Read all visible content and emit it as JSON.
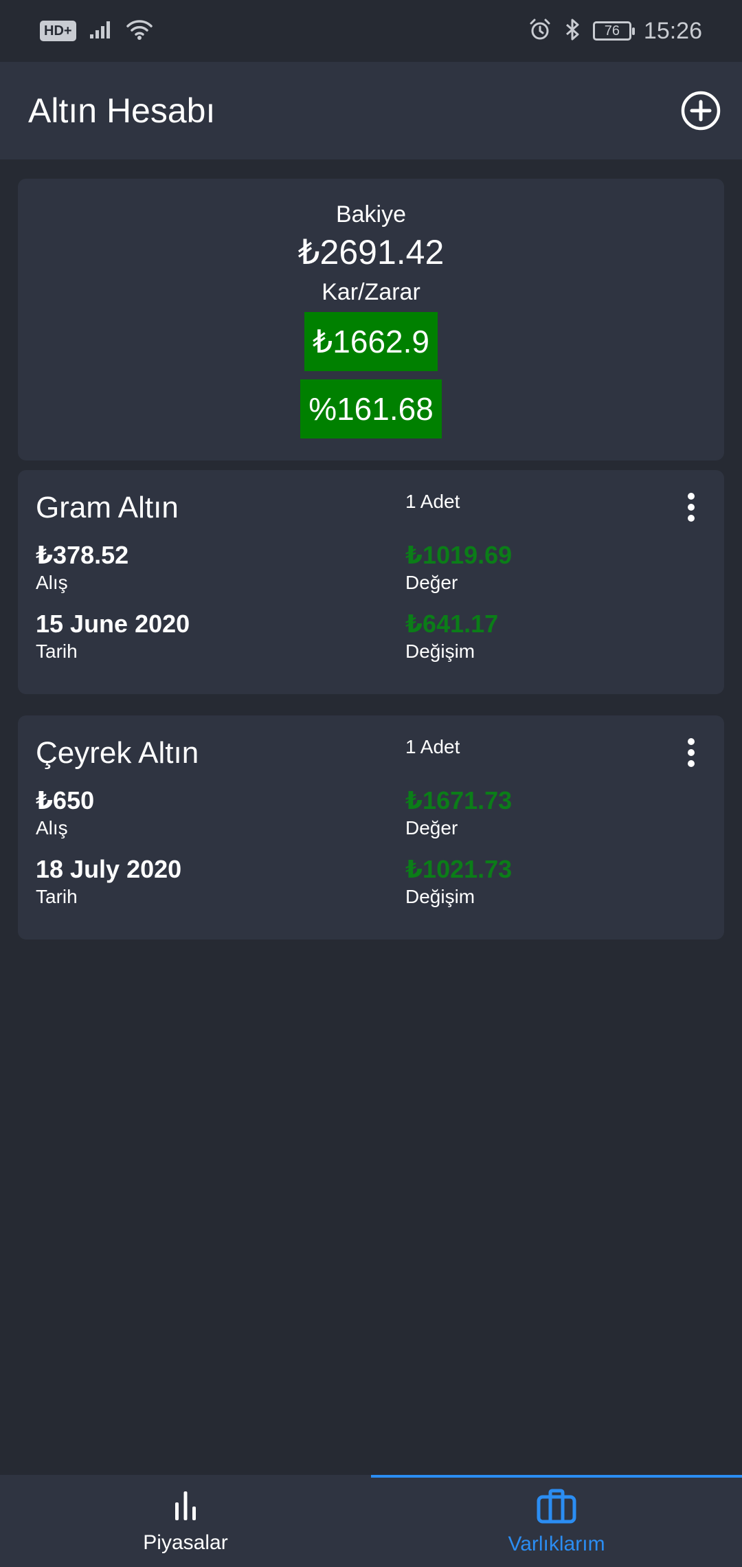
{
  "status_bar": {
    "hd_badge": "HD+",
    "battery": "76",
    "time": "15:26"
  },
  "app_bar": {
    "title": "Altın Hesabı"
  },
  "summary": {
    "balance_label": "Bakiye",
    "balance_value": "₺2691.42",
    "profit_label": "Kar/Zarar",
    "profit_value": "₺1662.9",
    "profit_percent": "%161.68"
  },
  "assets": [
    {
      "name": "Gram Altın",
      "quantity": "1 Adet",
      "buy_value": "₺378.52",
      "buy_label": "Alış",
      "date_value": "15 June 2020",
      "date_label": "Tarih",
      "worth_value": "₺1019.69",
      "worth_label": "Değer",
      "change_value": "₺641.17",
      "change_label": "Değişim"
    },
    {
      "name": "Çeyrek Altın",
      "quantity": "1 Adet",
      "buy_value": "₺650",
      "buy_label": "Alış",
      "date_value": "18 July 2020",
      "date_label": "Tarih",
      "worth_value": "₺1671.73",
      "worth_label": "Değer",
      "change_value": "₺1021.73",
      "change_label": "Değişim"
    }
  ],
  "bottom_nav": {
    "items": [
      {
        "label": "Piyasalar",
        "icon": "bar-chart-icon",
        "active": false
      },
      {
        "label": "Varlıklarım",
        "icon": "briefcase-icon",
        "active": true
      }
    ]
  },
  "colors": {
    "background": "#262a33",
    "surface": "#2f3441",
    "positive": "#008000",
    "accent": "#2b8df2"
  }
}
